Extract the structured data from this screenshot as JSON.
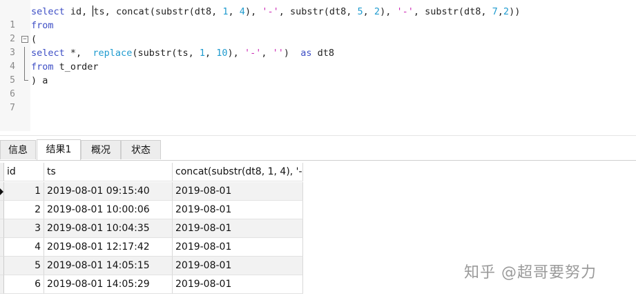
{
  "editor": {
    "lines": [
      {
        "no": "1"
      },
      {
        "no": "2"
      },
      {
        "no": "3"
      },
      {
        "no": "4"
      },
      {
        "no": "5"
      },
      {
        "no": "6"
      },
      {
        "no": "7"
      }
    ],
    "tokens": {
      "l1": [
        "select",
        " id, ",
        "ts, ",
        "concat",
        "(substr(dt8, ",
        "1",
        ", ",
        "4",
        "), ",
        "'-'",
        ", substr(dt8, ",
        "5",
        ", ",
        "2",
        "), ",
        "'-'",
        ", substr(dt8, ",
        "7",
        ",",
        "2",
        "))"
      ],
      "l2": [
        "from"
      ],
      "l3": [
        "("
      ],
      "l4": [
        "select",
        " *,  ",
        "replace",
        "(substr(ts, ",
        "1",
        ", ",
        "10",
        "), ",
        "'-'",
        ", ",
        "''",
        ")  ",
        "as",
        " dt8"
      ],
      "l5": [
        "from",
        " t_order"
      ],
      "l6": [
        ") a"
      ]
    }
  },
  "tabs": [
    {
      "label": "信息"
    },
    {
      "label": "结果1"
    },
    {
      "label": "概况"
    },
    {
      "label": "状态"
    }
  ],
  "results": {
    "columns": [
      "id",
      "ts",
      "concat(substr(dt8, 1, 4), '-"
    ],
    "rows": [
      [
        "1",
        "2019-08-01 09:15:40",
        "2019-08-01"
      ],
      [
        "2",
        "2019-08-01 10:00:06",
        "2019-08-01"
      ],
      [
        "3",
        "2019-08-01 10:04:35",
        "2019-08-01"
      ],
      [
        "4",
        "2019-08-01 12:17:42",
        "2019-08-01"
      ],
      [
        "5",
        "2019-08-01 14:05:15",
        "2019-08-01"
      ],
      [
        "6",
        "2019-08-01 14:05:29",
        "2019-08-01"
      ]
    ]
  },
  "watermark": "知乎 @超哥要努力",
  "colors": {
    "keyword": "#3d4ec5",
    "function": "#1f9bcf",
    "string": "#cc2ab5",
    "number": "#1f9bcf"
  }
}
